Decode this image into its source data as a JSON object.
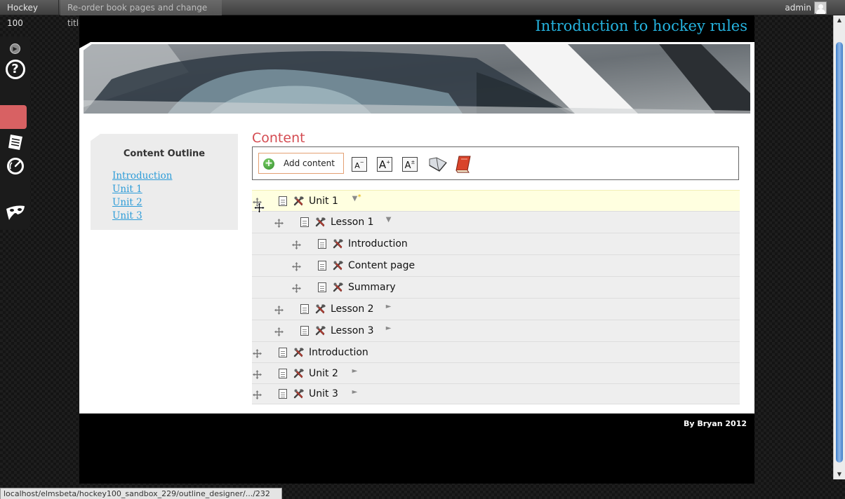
{
  "topbar": {
    "site_name": "Hockey 100",
    "active_tab": "Re-order book pages and change titles",
    "username": "admin"
  },
  "left_toolbar": {
    "icons": [
      "collapse-arrow-icon",
      "help-icon",
      "outline-list-icon",
      "dashboard-gauge-icon",
      "mask-icon"
    ]
  },
  "site": {
    "title": "Introduction to hockey rules",
    "footer": "By Bryan 2012"
  },
  "outline": {
    "title": "Content Outline",
    "links": [
      "Introduction",
      "Unit 1",
      "Unit 2",
      "Unit 3"
    ]
  },
  "content": {
    "heading": "Content",
    "add_content_label": "Add content",
    "format_buttons": [
      "A",
      "A",
      "A"
    ]
  },
  "tree": [
    {
      "title": "Unit 1",
      "level": 0,
      "toggle": "▼",
      "highlight": true,
      "star": "*"
    },
    {
      "title": "Lesson 1",
      "level": 1,
      "toggle": "▼"
    },
    {
      "title": "Introduction",
      "level": 2
    },
    {
      "title": "Content page",
      "level": 2
    },
    {
      "title": "Summary",
      "level": 2
    },
    {
      "title": "Lesson 2",
      "level": 1,
      "toggle": "►"
    },
    {
      "title": "Lesson 3",
      "level": 1,
      "toggle": "►"
    },
    {
      "title": "Introduction",
      "level": 0
    },
    {
      "title": "Unit 2",
      "level": 0,
      "toggle": "►"
    },
    {
      "title": "Unit 3",
      "level": 0,
      "toggle": "►"
    }
  ],
  "status_bar": {
    "url": "localhost/elmsbeta/hockey100_sandbox_229/outline_designer/.../232"
  },
  "colors": {
    "site_title": "#25b3df",
    "content_heading": "#d44c52",
    "link": "#2d9cd8",
    "highlight_row": "#ffffe0",
    "active_toolbar_button": "#d86163"
  }
}
